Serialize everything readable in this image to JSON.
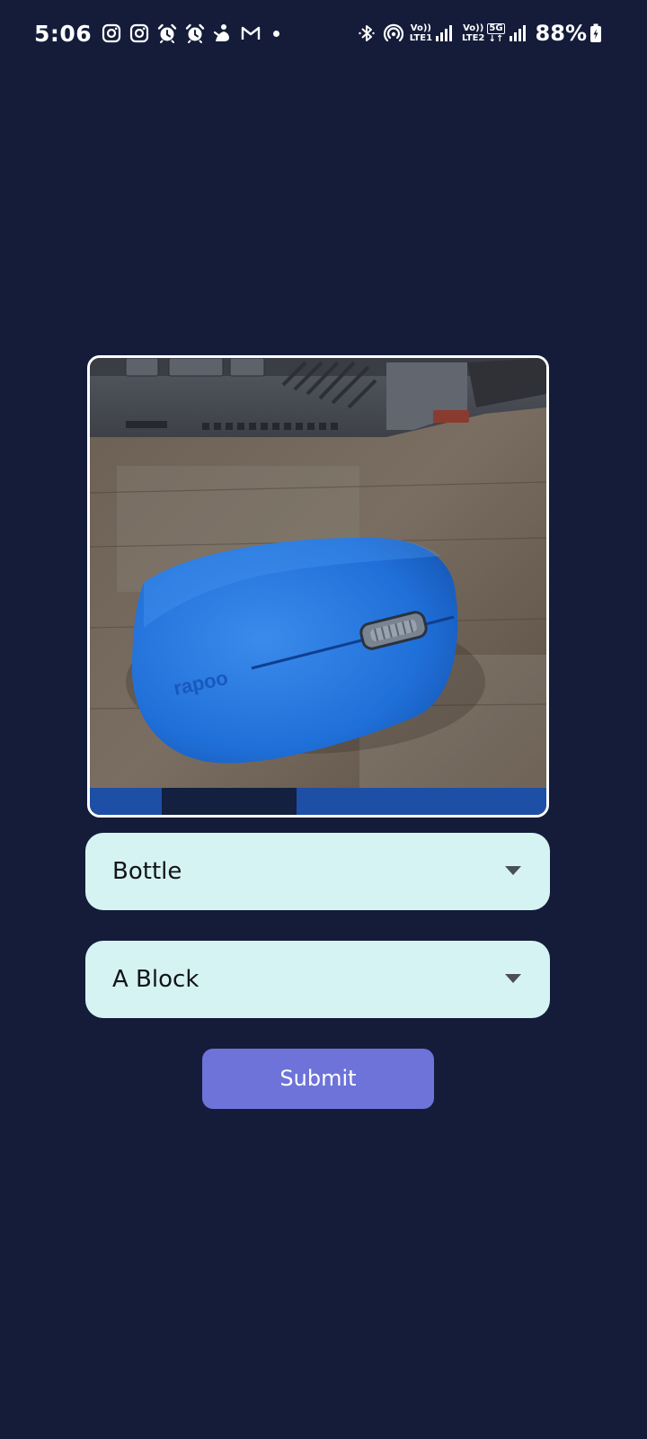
{
  "status_bar": {
    "time": "5:06",
    "left_icons": [
      "instagram-icon",
      "instagram-icon",
      "alarm-icon",
      "alarm-icon",
      "app-notification-icon",
      "gmail-icon"
    ],
    "network_1": {
      "top": "Vo))",
      "bottom": "LTE1"
    },
    "network_2": {
      "top": "Vo))",
      "bottom": "LTE2"
    },
    "fiveg": {
      "top": "5G",
      "bottom": "↓↑"
    },
    "battery": "88%"
  },
  "form": {
    "photo": {
      "description_icon": "photo-preview"
    },
    "dropdown_1": {
      "selected": "Bottle"
    },
    "dropdown_2": {
      "selected": "A Block"
    },
    "submit_label": "Submit"
  },
  "colors": {
    "background": "#141c3a",
    "dropdown_bg": "#d6f3f3",
    "submit_bg": "#6d73d8",
    "photo_border": "#ffffff"
  }
}
